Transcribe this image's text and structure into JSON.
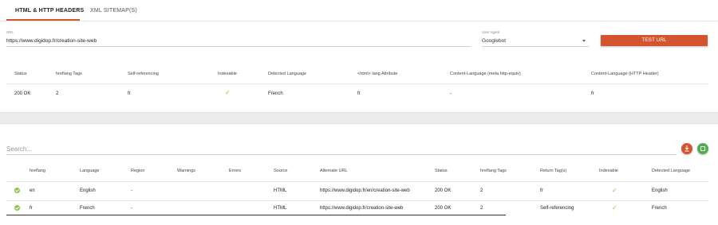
{
  "tabs": [
    {
      "label": "HTML & HTTP HEADERS",
      "active": true
    },
    {
      "label": "XML SITEMAP(S)",
      "active": false
    }
  ],
  "form": {
    "url_label": "URL",
    "url_value": "https://www.digidop.fr/creation-site-web",
    "ua_label": "User Agent",
    "ua_value": "Googlebot",
    "test_button": "TEST URL"
  },
  "summary": {
    "headers": [
      "Status",
      "hreflang Tags",
      "Self-referencing",
      "Indexable",
      "Detected Language",
      "<html> lang Attribute",
      "Content-Language (meta http-equiv)",
      "Content-Language (HTTP Header)"
    ],
    "row": {
      "status": "200 OK",
      "hreflang_tags": "2",
      "self_referencing": "fr",
      "indexable": "✓",
      "detected_language": "French",
      "html_lang": "fr",
      "content_lang_meta": "-",
      "content_lang_header": "fr"
    }
  },
  "search": {
    "placeholder": "Search..."
  },
  "table": {
    "headers": [
      "hreflang",
      "Language",
      "Region",
      "Warnings",
      "Errors",
      "Source",
      "Alternate URL",
      "Status",
      "hreflang Tags",
      "Return Tag(s)",
      "Indexable",
      "Detected Language"
    ],
    "rows": [
      {
        "hreflang": "en",
        "language": "English",
        "region": "-",
        "warnings": "",
        "errors": "",
        "source": "HTML",
        "alternate_url": "https://www.digidop.fr/en/creation-site-web",
        "status": "200 OK",
        "hreflang_tags": "2",
        "return_tags": "fr",
        "indexable": "✓",
        "detected_language": "English"
      },
      {
        "hreflang": "fr",
        "language": "French",
        "region": "-",
        "warnings": "",
        "errors": "",
        "source": "HTML",
        "alternate_url": "https://www.digidop.fr/creation-site-web",
        "status": "200 OK",
        "hreflang_tags": "2",
        "return_tags": "Self-referencing",
        "indexable": "✓",
        "detected_language": "French"
      }
    ]
  },
  "colors": {
    "accent": "#d4542f",
    "excel": "#4caf50",
    "check": "#8bc34a"
  },
  "icons": {
    "download": "download-icon",
    "export": "excel-icon",
    "row_status": "check-circle-icon",
    "indexable": "checkmark-icon"
  }
}
